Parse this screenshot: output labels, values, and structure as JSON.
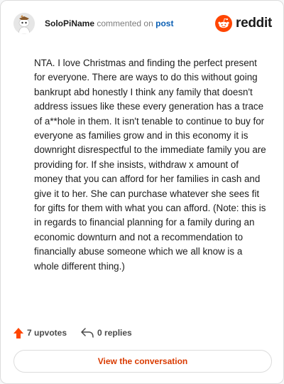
{
  "header": {
    "username": "SoloPiName",
    "action_text": "commented on",
    "target_link": "post",
    "brand": "reddit"
  },
  "comment": {
    "body": "NTA. I love Christmas and finding the perfect present for everyone. There are ways to do this without going bankrupt abd honestly I think any family that doesn't address issues like these every generation has a trace of a**hole in them. It isn't tenable to continue to buy for everyone as families grow and in this economy it is downright disrespectful to the immediate family you are providing for. If she insists, withdraw x amount of money that you can afford for her families in cash and give it to her. She can purchase whatever she sees fit for gifts for them with what you can afford. (Note: this is in regards to financial planning for a family during an economic downturn and not a recommendation to financially abuse someone which we all know is a whole different thing.)"
  },
  "footer": {
    "upvotes": "7 upvotes",
    "replies": "0 replies",
    "view_button": "View the conversation"
  },
  "colors": {
    "accent": "#d93a00",
    "brand_orange": "#ff4500",
    "link": "#0a5fb4"
  },
  "icons": {
    "avatar": "snoo-avatar-icon",
    "brand": "reddit-logo-icon",
    "upvote": "upvote-arrow-icon",
    "reply": "reply-arrow-icon"
  }
}
